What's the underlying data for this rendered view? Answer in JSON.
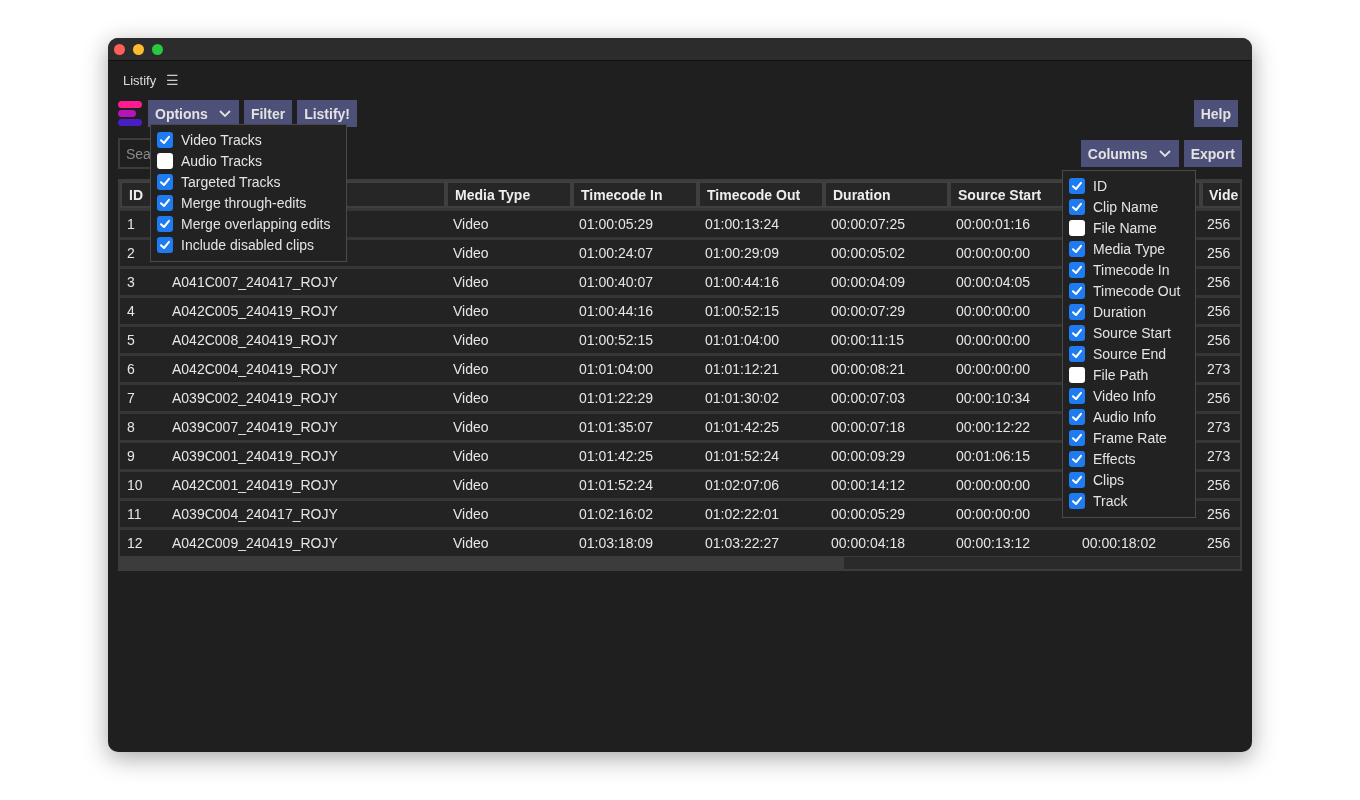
{
  "window": {
    "title": "Listify",
    "menu_glyph": "☰"
  },
  "toolbar": {
    "buttons": [
      {
        "label": "Options",
        "kind": "dropdown"
      },
      {
        "label": "Filter",
        "kind": "plain"
      },
      {
        "label": "Listify!",
        "kind": "plain"
      }
    ],
    "help": {
      "label": "Help"
    }
  },
  "search": {
    "placeholder": "Sea"
  },
  "actions": [
    {
      "label": "Columns",
      "kind": "dropdown"
    },
    {
      "label": "Export",
      "kind": "plain"
    }
  ],
  "options_menu": [
    {
      "label": "Video Tracks",
      "checked": true
    },
    {
      "label": "Audio Tracks",
      "checked": false
    },
    {
      "label": "Targeted Tracks",
      "checked": true
    },
    {
      "label": "Merge through-edits",
      "checked": true
    },
    {
      "label": "Merge overlapping edits",
      "checked": true
    },
    {
      "label": "Include disabled clips",
      "checked": true
    }
  ],
  "columns_menu": [
    {
      "label": "ID",
      "checked": true
    },
    {
      "label": "Clip Name",
      "checked": true
    },
    {
      "label": "File Name",
      "checked": false
    },
    {
      "label": "Media Type",
      "checked": true
    },
    {
      "label": "Timecode In",
      "checked": true
    },
    {
      "label": "Timecode Out",
      "checked": true
    },
    {
      "label": "Duration",
      "checked": true
    },
    {
      "label": "Source Start",
      "checked": true
    },
    {
      "label": "Source End",
      "checked": true
    },
    {
      "label": "File Path",
      "checked": false
    },
    {
      "label": "Video Info",
      "checked": true
    },
    {
      "label": "Audio Info",
      "checked": true
    },
    {
      "label": "Frame Rate",
      "checked": true
    },
    {
      "label": "Effects",
      "checked": true
    },
    {
      "label": "Clips",
      "checked": true
    },
    {
      "label": "Track",
      "checked": true
    }
  ],
  "table": {
    "columns": [
      {
        "label": "ID"
      },
      {},
      {
        "label": "Media Type"
      },
      {
        "label": "Timecode In"
      },
      {
        "label": "Timecode Out"
      },
      {
        "label": "Duration"
      },
      {
        "label": "Source Start"
      },
      {},
      {
        "label": "Vide"
      }
    ],
    "rows": [
      {
        "cells": [
          {
            "text": "1"
          },
          {},
          {
            "text": "Video"
          },
          {
            "text": "01:00:05:29"
          },
          {
            "text": "01:00:13:24"
          },
          {
            "text": "00:00:07:25"
          },
          {
            "text": "00:00:01:16"
          },
          {},
          {
            "text": "256"
          }
        ]
      },
      {
        "cells": [
          {
            "text": "2"
          },
          {},
          {
            "text": "Video"
          },
          {
            "text": "01:00:24:07"
          },
          {
            "text": "01:00:29:09"
          },
          {
            "text": "00:00:05:02"
          },
          {
            "text": "00:00:00:00"
          },
          {},
          {
            "text": "256"
          }
        ]
      },
      {
        "cells": [
          {
            "text": "3"
          },
          {
            "text": "A041C007_240417_ROJY"
          },
          {
            "text": "Video"
          },
          {
            "text": "01:00:40:07"
          },
          {
            "text": "01:00:44:16"
          },
          {
            "text": "00:00:04:09"
          },
          {
            "text": "00:00:04:05"
          },
          {},
          {
            "text": "256"
          }
        ]
      },
      {
        "cells": [
          {
            "text": "4"
          },
          {
            "text": "A042C005_240419_ROJY"
          },
          {
            "text": "Video"
          },
          {
            "text": "01:00:44:16"
          },
          {
            "text": "01:00:52:15"
          },
          {
            "text": "00:00:07:29"
          },
          {
            "text": "00:00:00:00"
          },
          {},
          {
            "text": "256"
          }
        ]
      },
      {
        "cells": [
          {
            "text": "5"
          },
          {
            "text": "A042C008_240419_ROJY"
          },
          {
            "text": "Video"
          },
          {
            "text": "01:00:52:15"
          },
          {
            "text": "01:01:04:00"
          },
          {
            "text": "00:00:11:15"
          },
          {
            "text": "00:00:00:00"
          },
          {},
          {
            "text": "256"
          }
        ]
      },
      {
        "cells": [
          {
            "text": "6"
          },
          {
            "text": "A042C004_240419_ROJY"
          },
          {
            "text": "Video"
          },
          {
            "text": "01:01:04:00"
          },
          {
            "text": "01:01:12:21"
          },
          {
            "text": "00:00:08:21"
          },
          {
            "text": "00:00:00:00"
          },
          {},
          {
            "text": "273"
          }
        ]
      },
      {
        "cells": [
          {
            "text": "7"
          },
          {
            "text": "A039C002_240419_ROJY"
          },
          {
            "text": "Video"
          },
          {
            "text": "01:01:22:29"
          },
          {
            "text": "01:01:30:02"
          },
          {
            "text": "00:00:07:03"
          },
          {
            "text": "00:00:10:34"
          },
          {},
          {
            "text": "256"
          }
        ]
      },
      {
        "cells": [
          {
            "text": "8"
          },
          {
            "text": "A039C007_240419_ROJY"
          },
          {
            "text": "Video"
          },
          {
            "text": "01:01:35:07"
          },
          {
            "text": "01:01:42:25"
          },
          {
            "text": "00:00:07:18"
          },
          {
            "text": "00:00:12:22"
          },
          {},
          {
            "text": "273"
          }
        ]
      },
      {
        "cells": [
          {
            "text": "9"
          },
          {
            "text": "A039C001_240419_ROJY"
          },
          {
            "text": "Video"
          },
          {
            "text": "01:01:42:25"
          },
          {
            "text": "01:01:52:24"
          },
          {
            "text": "00:00:09:29"
          },
          {
            "text": "00:01:06:15"
          },
          {},
          {
            "text": "273"
          }
        ]
      },
      {
        "cells": [
          {
            "text": "10"
          },
          {
            "text": "A042C001_240419_ROJY"
          },
          {
            "text": "Video"
          },
          {
            "text": "01:01:52:24"
          },
          {
            "text": "01:02:07:06"
          },
          {
            "text": "00:00:14:12"
          },
          {
            "text": "00:00:00:00"
          },
          {},
          {
            "text": "256"
          }
        ]
      },
      {
        "cells": [
          {
            "text": "11"
          },
          {
            "text": "A039C004_240417_ROJY"
          },
          {
            "text": "Video"
          },
          {
            "text": "01:02:16:02"
          },
          {
            "text": "01:02:22:01"
          },
          {
            "text": "00:00:05:29"
          },
          {
            "text": "00:00:00:00"
          },
          {},
          {
            "text": "256"
          }
        ]
      },
      {
        "cells": [
          {
            "text": "12"
          },
          {
            "text": "A042C009_240419_ROJY"
          },
          {
            "text": "Video"
          },
          {
            "text": "01:03:18:09"
          },
          {
            "text": "01:03:22:27"
          },
          {
            "text": "00:00:04:18"
          },
          {
            "text": "00:00:13:12"
          },
          {
            "text": "00:00:18:02"
          },
          {
            "text": "256"
          }
        ]
      }
    ]
  }
}
